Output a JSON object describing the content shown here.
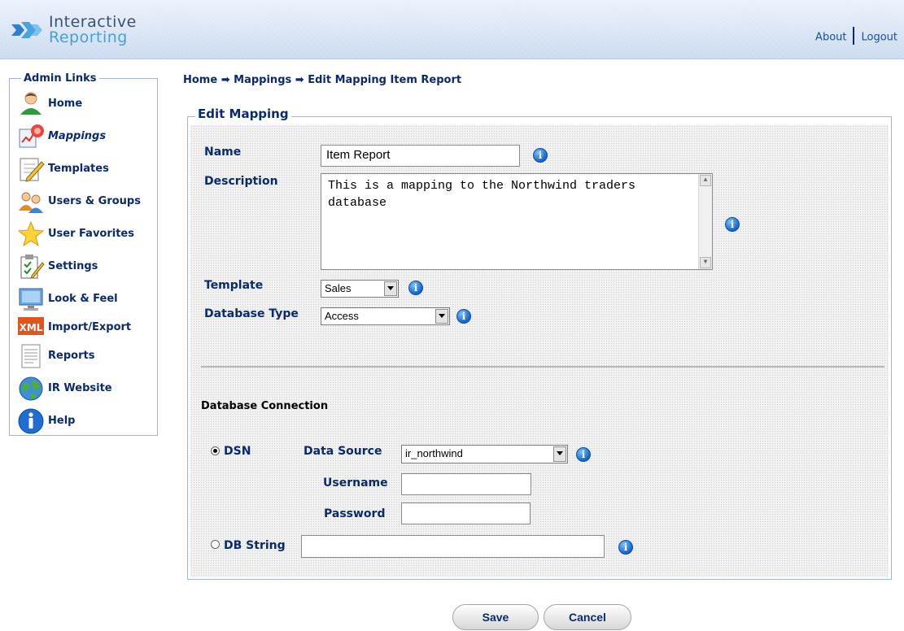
{
  "header": {
    "logo_line1": "Interactive",
    "logo_line2": "Reporting",
    "about": "About",
    "logout": "Logout"
  },
  "sidebar": {
    "title": "Admin Links",
    "items": [
      {
        "label": "Home",
        "icon": "user-home-icon"
      },
      {
        "label": "Mappings",
        "icon": "mappings-icon",
        "active": true
      },
      {
        "label": "Templates",
        "icon": "pencil-document-icon"
      },
      {
        "label": "Users & Groups",
        "icon": "users-icon"
      },
      {
        "label": "User Favorites",
        "icon": "star-icon"
      },
      {
        "label": "Settings",
        "icon": "clipboard-settings-icon"
      },
      {
        "label": "Look & Feel",
        "icon": "monitor-icon"
      },
      {
        "label": "Import/Export",
        "icon": "xml-icon"
      },
      {
        "label": "Reports",
        "icon": "report-document-icon"
      },
      {
        "label": "IR Website",
        "icon": "globe-icon"
      },
      {
        "label": "Help",
        "icon": "help-info-icon"
      }
    ]
  },
  "breadcrumb": {
    "home": "Home",
    "arrow": "➡",
    "mappings": "Mappings",
    "current": "Edit Mapping Item Report"
  },
  "form": {
    "legend": "Edit Mapping",
    "name_label": "Name",
    "name_value": "Item Report",
    "description_label": "Description",
    "description_value": "This is a mapping to the Northwind traders database",
    "template_label": "Template",
    "template_value": "Sales",
    "dbtype_label": "Database Type",
    "dbtype_value": "Access",
    "connection_title": "Database Connection",
    "dsn_label": "DSN",
    "datasource_label": "Data Source",
    "datasource_value": "ir_northwind",
    "username_label": "Username",
    "username_value": "",
    "password_label": "Password",
    "password_value": "",
    "dbstring_label": "DB String",
    "dbstring_value": "",
    "info_glyph": "i"
  },
  "buttons": {
    "save": "Save",
    "cancel": "Cancel"
  },
  "colors": {
    "label": "#0b2a6e",
    "link": "#1a4fa0",
    "info": "#1565c8"
  }
}
